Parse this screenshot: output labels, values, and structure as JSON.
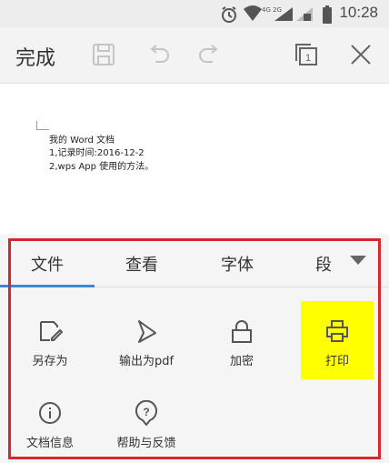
{
  "status_bar": {
    "network": "4G 2G",
    "time": "10:28",
    "icons": [
      "alarm-icon",
      "wifi-icon",
      "signal-icon",
      "sim-signal-icon",
      "battery-icon"
    ]
  },
  "toolbar": {
    "done_label": "完成",
    "icons": [
      "save-icon",
      "undo-icon",
      "redo-icon",
      "page-count-icon",
      "close-icon"
    ],
    "page_count": "1"
  },
  "document": {
    "lines": [
      "我的 Word 文档",
      "1,记录时间:2016-12-2",
      "2,wps App 使用的方法。"
    ]
  },
  "tabs": {
    "items": [
      "文件",
      "查看",
      "字体",
      "段"
    ],
    "active": "文件",
    "accent": "#3b86d8"
  },
  "tools": [
    {
      "label": "另存为",
      "icon": "save-as-icon"
    },
    {
      "label": "输出为pdf",
      "icon": "export-pdf-icon"
    },
    {
      "label": "加密",
      "icon": "lock-icon"
    },
    {
      "label": "打印",
      "icon": "print-icon",
      "highlight": "#ffff00"
    },
    {
      "label": "文档信息",
      "icon": "info-icon"
    },
    {
      "label": "帮助与反馈",
      "icon": "help-icon"
    }
  ],
  "annotation_color": "#d9262c"
}
